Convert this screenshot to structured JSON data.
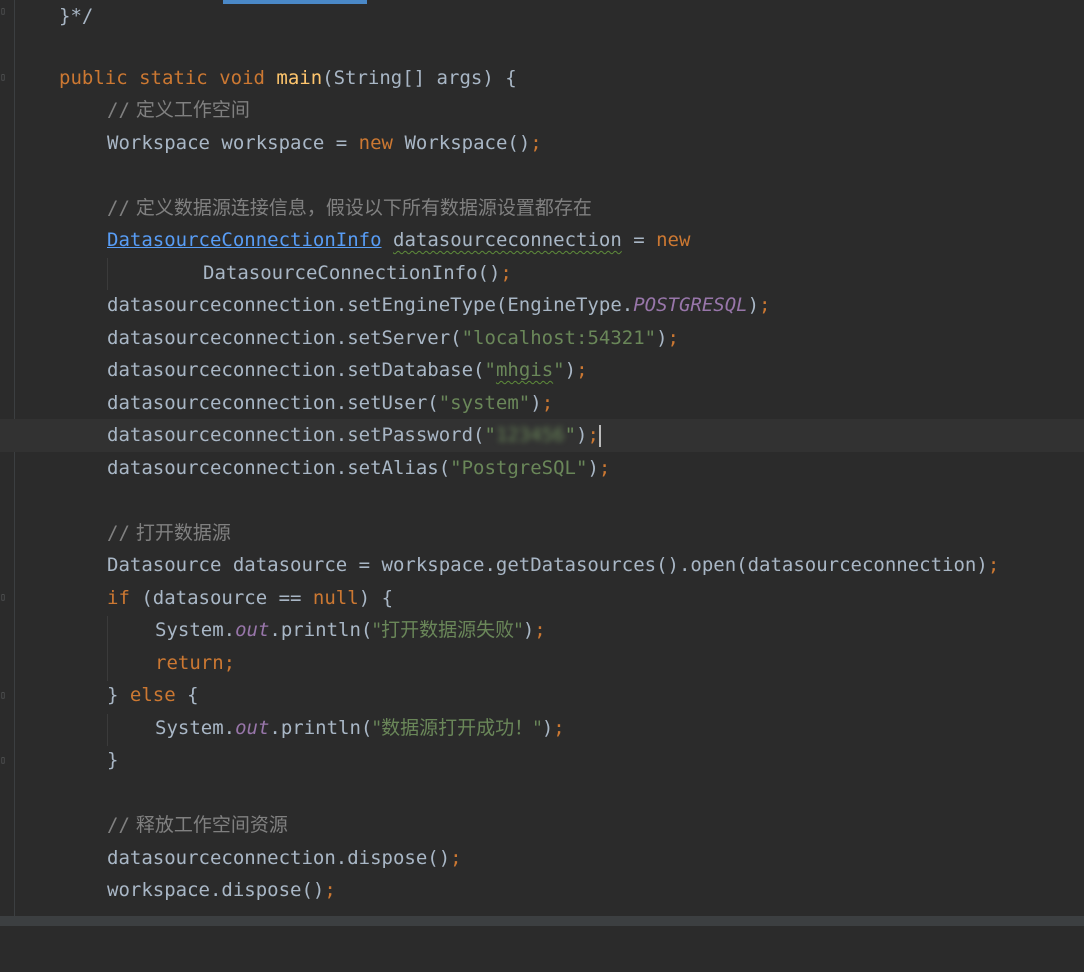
{
  "editor": {
    "line0": {
      "text": "}*/"
    },
    "line2": {
      "kw1": "public",
      "kw2": "static",
      "kw3": "void",
      "fn": "main",
      "rest": "(String[] args) {"
    },
    "line3": {
      "slashes": "//",
      "text": " 定义工作空间"
    },
    "line4": {
      "a": "Workspace workspace = ",
      "kw": "new",
      "b": " Workspace()",
      "semi": ";"
    },
    "line6": {
      "slashes": "//",
      "text": " 定义数据源连接信息，假设以下所有数据源设置都存在"
    },
    "line7": {
      "type": "DatasourceConnectionInfo",
      "var": "datasourceconnection",
      "eq": " = ",
      "kw": "new"
    },
    "line8": {
      "a": "DatasourceConnectionInfo()",
      "semi": ";"
    },
    "line9": {
      "a": "datasourceconnection.setEngineType(EngineType.",
      "field": "POSTGRESQL",
      "b": ")",
      "semi": ";"
    },
    "line10": {
      "a": "datasourceconnection.setServer(",
      "str": "\"localhost:54321\"",
      "b": ")",
      "semi": ";"
    },
    "line11": {
      "a": "datasourceconnection.setDatabase(",
      "q1": "\"",
      "str": "mhgis",
      "q2": "\"",
      "b": ")",
      "semi": ";"
    },
    "line12": {
      "a": "datasourceconnection.setUser(",
      "str": "\"system\"",
      "b": ")",
      "semi": ";"
    },
    "line13": {
      "a": "datasourceconnection.setPassword(",
      "q1": "\"",
      "str": "123456",
      "q2": "\"",
      "b": ")",
      "semi": ";"
    },
    "line14": {
      "a": "datasourceconnection.setAlias(",
      "str": "\"PostgreSQL\"",
      "b": ")",
      "semi": ";"
    },
    "line16": {
      "slashes": "//",
      "text": " 打开数据源"
    },
    "line17": {
      "a": "Datasource datasource = workspace.getDatasources().open(datasourceconnection)",
      "semi": ";"
    },
    "line18": {
      "kw": "if",
      "a": " (datasource == ",
      "kw2": "null",
      "b": ") {"
    },
    "line19": {
      "a": "System.",
      "field": "out",
      "b": ".println(",
      "str": "\"打开数据源失败\"",
      "c": ")",
      "semi": ";"
    },
    "line20": {
      "kw": "return",
      "semi": ";"
    },
    "line21": {
      "a": "} ",
      "kw": "else",
      "b": " {"
    },
    "line22": {
      "a": "System.",
      "field": "out",
      "b": ".println(",
      "str": "\"数据源打开成功！\"",
      "c": ")",
      "semi": ";"
    },
    "line23": {
      "a": "}"
    },
    "line25": {
      "slashes": "//",
      "text": " 释放工作空间资源"
    },
    "line26": {
      "a": "datasourceconnection.dispose()",
      "semi": ";"
    },
    "line27": {
      "a": "workspace.dispose()",
      "semi": ";"
    }
  },
  "icons": [
    "fold-icon"
  ],
  "colors": {
    "background": "#2b2b2b",
    "keyword": "#cc7832",
    "method_decl": "#ffc66d",
    "string": "#6a8759",
    "comment": "#808080",
    "static_field": "#9876aa",
    "link": "#589df6",
    "text": "#a9b7c6"
  }
}
